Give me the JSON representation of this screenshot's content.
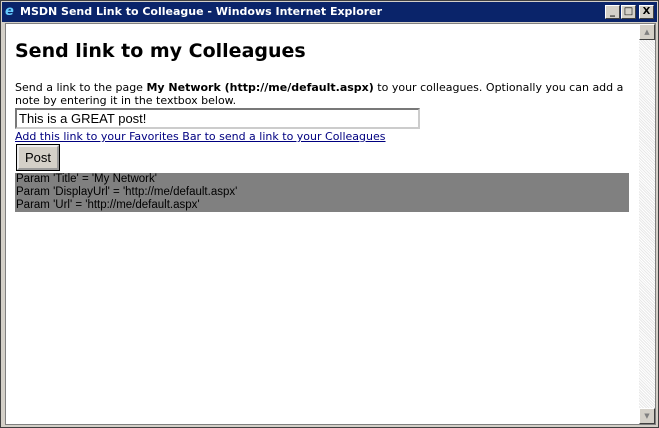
{
  "window": {
    "title": "MSDN Send Link to Colleague - Windows Internet Explorer",
    "minimize": "_",
    "maximize": "□",
    "close": "X"
  },
  "page": {
    "heading": "Send link to my Colleagues",
    "desc_pre": "Send a link to the page ",
    "desc_bold": "My Network (http://me/default.aspx)",
    "desc_post": " to your colleagues. Optionally you can add a note by entering it in the textbox below.",
    "note_value": "This is a GREAT post!",
    "favorites_link": "Add this link to your Favorites Bar to send a link to your Colleagues",
    "post_label": "Post",
    "params": [
      "Param 'Title' = 'My Network'",
      "Param 'DisplayUrl' = 'http://me/default.aspx'",
      "Param 'Url' = 'http://me/default.aspx'"
    ]
  }
}
